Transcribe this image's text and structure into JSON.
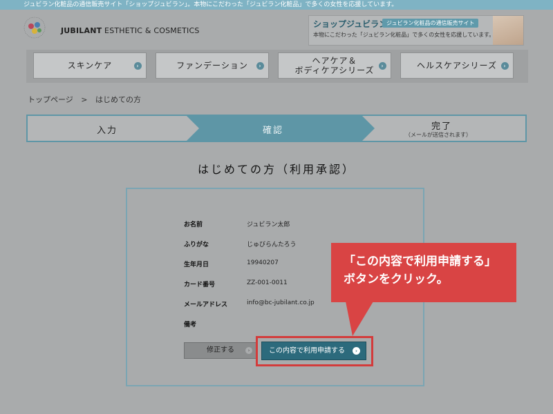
{
  "topbar": {
    "text": "ジュビラン化粧品の通信販売サイト「ショップジュビラン」。本物にこだわった「ジュビラン化粧品」で多くの女性を応援しています。"
  },
  "header": {
    "brand_name": "JUBILANT",
    "brand_tagline": "ESTHETIC & COSMETICS",
    "promo_title": "ショップジュビラン",
    "promo_badge": "ジュビラン化粧品の通信販売サイト",
    "promo_desc": "本物にこだわった「ジュビラン化粧品」で多くの女性を応援しています。"
  },
  "nav": {
    "items": [
      {
        "label": "スキンケア"
      },
      {
        "label": "ファンデーション"
      },
      {
        "label": "ヘアケア＆\nボディケアシリーズ"
      },
      {
        "label": "ヘルスケアシリーズ"
      }
    ]
  },
  "breadcrumb": {
    "home": "トップページ",
    "separator": ">",
    "current": "はじめての方"
  },
  "steps": {
    "step1": "入力",
    "step2": "確認",
    "step3": "完了",
    "step3_sub": "（メールが送信されます）"
  },
  "page": {
    "title": "はじめての方（利用承認）"
  },
  "form": {
    "fields": [
      {
        "label": "お名前",
        "value": "ジュビラン太郎"
      },
      {
        "label": "ふりがな",
        "value": "じゅびらんたろう"
      },
      {
        "label": "生年月日",
        "value": "19940207"
      },
      {
        "label": "カード番号",
        "value": "ZZ-001-0011"
      },
      {
        "label": "メールアドレス",
        "value": "info@bc-jubilant.co.jp"
      },
      {
        "label": "備考",
        "value": ""
      }
    ],
    "edit_label": "修正する",
    "apply_label": "この内容で利用申請する"
  },
  "callout": {
    "line1": "「この内容で利用申請する」",
    "line2": "ボタンをクリック。"
  },
  "colors": {
    "accent": "#5e96a6",
    "button": "#2c6a7c",
    "highlight": "#d33b3b",
    "callout": "#d94444"
  }
}
